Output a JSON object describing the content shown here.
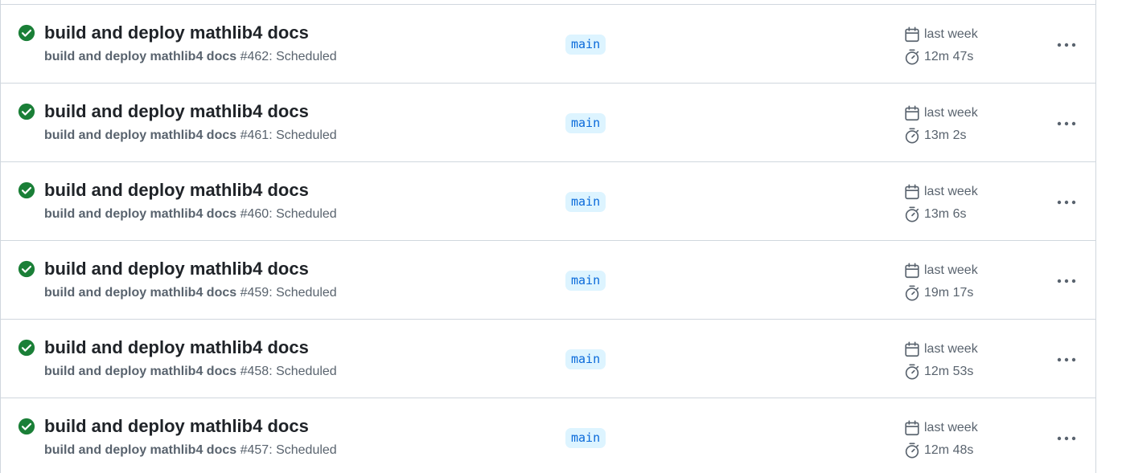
{
  "colors": {
    "success": "#1a7f37",
    "branch_bg": "#ddf4ff",
    "branch_text": "#0969da",
    "border": "#d0d7de",
    "muted": "#59636e"
  },
  "icons": {
    "status": "check-circle-fill-icon",
    "date": "calendar-icon",
    "duration": "stopwatch-icon",
    "menu": "kebab-horizontal-icon"
  },
  "runs": [
    {
      "title": "build and deploy mathlib4 docs",
      "workflow": "build and deploy mathlib4 docs",
      "run_info": "#462: Scheduled",
      "branch": "main",
      "date": "last week",
      "duration": "12m 47s"
    },
    {
      "title": "build and deploy mathlib4 docs",
      "workflow": "build and deploy mathlib4 docs",
      "run_info": "#461: Scheduled",
      "branch": "main",
      "date": "last week",
      "duration": "13m 2s"
    },
    {
      "title": "build and deploy mathlib4 docs",
      "workflow": "build and deploy mathlib4 docs",
      "run_info": "#460: Scheduled",
      "branch": "main",
      "date": "last week",
      "duration": "13m 6s"
    },
    {
      "title": "build and deploy mathlib4 docs",
      "workflow": "build and deploy mathlib4 docs",
      "run_info": "#459: Scheduled",
      "branch": "main",
      "date": "last week",
      "duration": "19m 17s"
    },
    {
      "title": "build and deploy mathlib4 docs",
      "workflow": "build and deploy mathlib4 docs",
      "run_info": "#458: Scheduled",
      "branch": "main",
      "date": "last week",
      "duration": "12m 53s"
    },
    {
      "title": "build and deploy mathlib4 docs",
      "workflow": "build and deploy mathlib4 docs",
      "run_info": "#457: Scheduled",
      "branch": "main",
      "date": "last week",
      "duration": "12m 48s"
    }
  ]
}
